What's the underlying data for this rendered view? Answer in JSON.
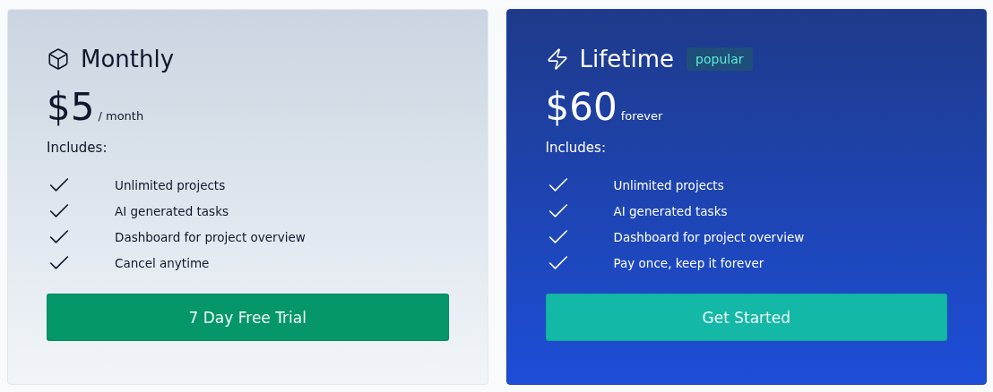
{
  "plans": [
    {
      "kind": "light",
      "name": "Monthly",
      "price": "$5",
      "period": "/ month",
      "includes_label": "Includes:",
      "features": [
        "Unlimited projects",
        "AI generated tasks",
        "Dashboard for project overview",
        "Cancel anytime"
      ],
      "button": "7 Day Free Trial"
    },
    {
      "kind": "dark",
      "name": "Lifetime",
      "badge": "popular",
      "price": "$60",
      "period": "forever",
      "includes_label": "Includes:",
      "features": [
        "Unlimited projects",
        "AI generated tasks",
        "Dashboard for project overview",
        "Pay once, keep it forever"
      ],
      "button": "Get Started"
    }
  ]
}
